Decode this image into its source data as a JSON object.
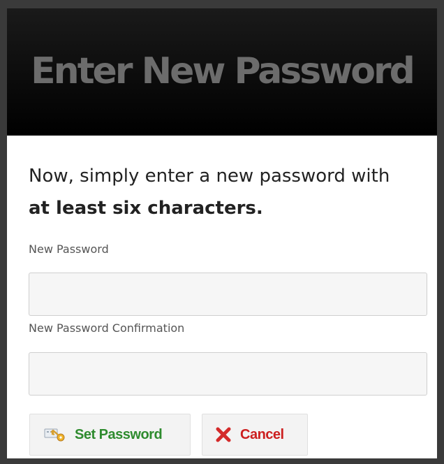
{
  "dialog": {
    "title": "Enter New Password",
    "intro_text": "Now, simply enter a new password with",
    "intro_emphasis": "at least six characters.",
    "fields": {
      "new_password_label": "New Password",
      "new_password_value": "",
      "confirmation_label": "New Password Confirmation",
      "confirmation_value": ""
    },
    "buttons": {
      "set_password_label": "Set Password",
      "cancel_label": "Cancel"
    },
    "icons": {
      "set_password_icon": "key-icon",
      "cancel_icon": "x-icon"
    },
    "colors": {
      "header_bg": "#000000",
      "title_text": "#6c6c6c",
      "set_password_text": "#2e8b2e",
      "cancel_text": "#cc1f1f"
    }
  }
}
